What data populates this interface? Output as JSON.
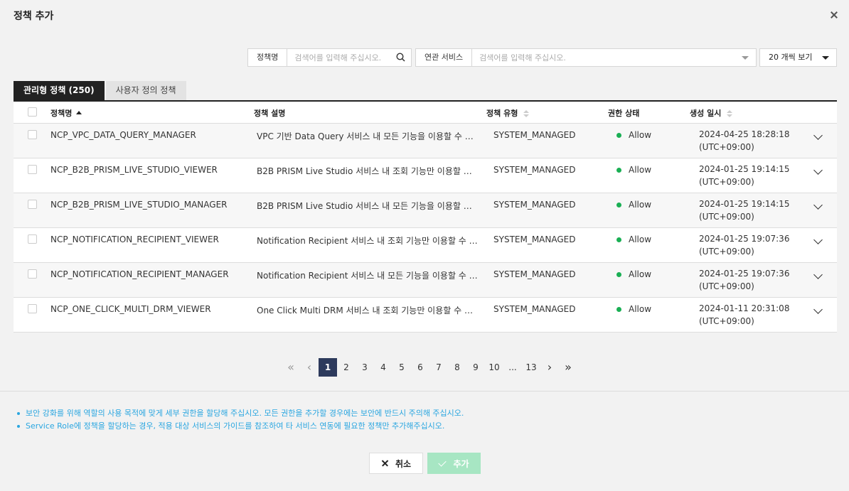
{
  "modal": {
    "title": "정책 추가"
  },
  "search": {
    "label": "정책명",
    "placeholder": "검색어를 입력해 주십시오."
  },
  "service_filter": {
    "label": "연관 서비스",
    "placeholder": "검색어를 입력해 주십시오."
  },
  "per_page": {
    "value": "20 개씩 보기"
  },
  "tabs": [
    {
      "label": "관리형 정책 (250)",
      "active": true
    },
    {
      "label": "사용자 정의 정책",
      "active": false
    }
  ],
  "table": {
    "columns": [
      "정책명",
      "정책 설명",
      "정책 유형",
      "권한 상태",
      "생성 일시"
    ],
    "rows": [
      {
        "name": "NCP_VPC_DATA_QUERY_MANAGER",
        "desc": "VPC 기반 Data Query 서비스 내 모든 기능을 이용할 수 있는 권한",
        "type": "SYSTEM_MANAGED",
        "status": "Allow",
        "date": "2024-04-25 18:28:18",
        "tz": "(UTC+09:00)"
      },
      {
        "name": "NCP_B2B_PRISM_LIVE_STUDIO_VIEWER",
        "desc": "B2B PRISM Live Studio 서비스 내 조회 기능만 이용할 수 있는 ...",
        "type": "SYSTEM_MANAGED",
        "status": "Allow",
        "date": "2024-01-25 19:14:15",
        "tz": "(UTC+09:00)"
      },
      {
        "name": "NCP_B2B_PRISM_LIVE_STUDIO_MANAGER",
        "desc": "B2B PRISM Live Studio 서비스 내 모든 기능을 이용할 수 있는 ...",
        "type": "SYSTEM_MANAGED",
        "status": "Allow",
        "date": "2024-01-25 19:14:15",
        "tz": "(UTC+09:00)"
      },
      {
        "name": "NCP_NOTIFICATION_RECIPIENT_VIEWER",
        "desc": "Notification Recipient 서비스 내 조회 기능만 이용할 수 있는 권...",
        "type": "SYSTEM_MANAGED",
        "status": "Allow",
        "date": "2024-01-25 19:07:36",
        "tz": "(UTC+09:00)"
      },
      {
        "name": "NCP_NOTIFICATION_RECIPIENT_MANAGER",
        "desc": "Notification Recipient 서비스 내 모든 기능을 이용할 수 있는 권...",
        "type": "SYSTEM_MANAGED",
        "status": "Allow",
        "date": "2024-01-25 19:07:36",
        "tz": "(UTC+09:00)"
      },
      {
        "name": "NCP_ONE_CLICK_MULTI_DRM_VIEWER",
        "desc": "One Click Multi DRM 서비스 내 조회 기능만 이용할 수 있는 권한",
        "type": "SYSTEM_MANAGED",
        "status": "Allow",
        "date": "2024-01-11 20:31:08",
        "tz": "(UTC+09:00)"
      }
    ]
  },
  "pagination": {
    "pages": [
      "1",
      "2",
      "3",
      "4",
      "5",
      "6",
      "7",
      "8",
      "9",
      "10",
      "...",
      "13"
    ],
    "current": "1",
    "first": "«",
    "prev": "‹",
    "next": "›",
    "last": "»"
  },
  "notes": [
    "보안 강화를 위해 역할의 사용 목적에 맞게 세부 권한을 할당해 주십시오. 모든 권한을 추가할 경우에는 보안에 반드시 주의해 주십시오.",
    "Service Role에 정책을 할당하는 경우, 적용 대상 서비스의 가이드를 참조하여 타 서비스 연동에 필요한 정책만 추가해주십시오."
  ],
  "buttons": {
    "cancel": "취소",
    "add": "추가"
  },
  "colors": {
    "accent": "#2d3a5c",
    "status_allow": "#1aaf54",
    "note": "#2aa6e0",
    "add_button": "#a7e6c3"
  }
}
